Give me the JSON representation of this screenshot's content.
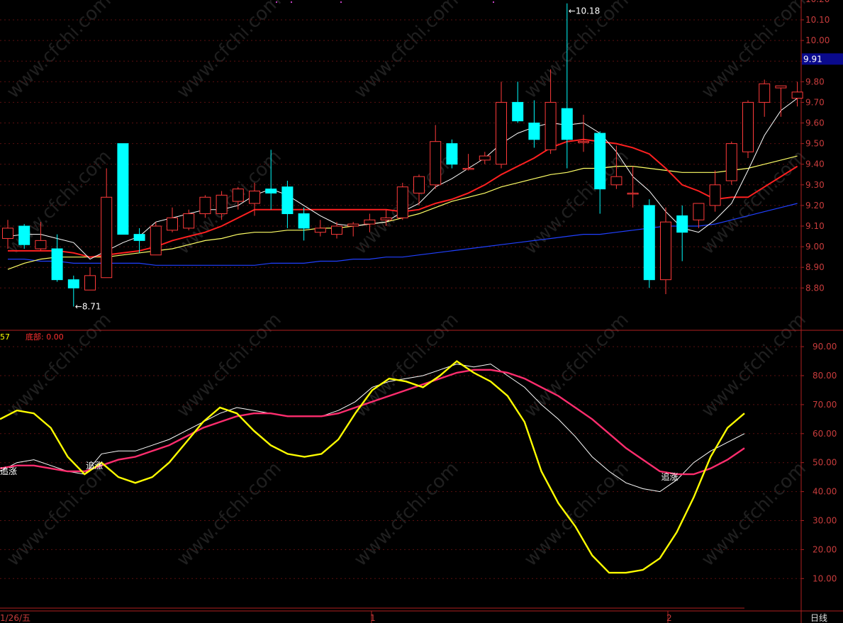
{
  "chart_data": [
    {
      "type": "candlestick",
      "colors": {
        "up": "#ff3a3a",
        "down": "#00ffff",
        "ma5": "#ffffff",
        "ma10": "#ff2020",
        "ma20": "#ffff66",
        "ma60": "#2040ff"
      },
      "ylim": [
        8.7,
        10.2
      ],
      "y_ticks": [
        "10.20",
        "10.10",
        "10.00",
        "9.90",
        "9.80",
        "9.70",
        "9.60",
        "9.50",
        "9.40",
        "9.30",
        "9.20",
        "9.10",
        "9.00",
        "8.90",
        "8.80"
      ],
      "current_price": "9.91",
      "annotations": {
        "high_label": "10.18",
        "low_label": "8.71"
      },
      "candles": [
        [
          9.04,
          9.09,
          8.99,
          9.13
        ],
        [
          9.1,
          9.01,
          8.99,
          9.11
        ],
        [
          8.99,
          9.03,
          8.98,
          9.12
        ],
        [
          8.99,
          8.84,
          8.83,
          9.06
        ],
        [
          8.84,
          8.8,
          8.71,
          8.86
        ],
        [
          8.79,
          8.86,
          8.79,
          8.9
        ],
        [
          8.85,
          9.24,
          8.85,
          9.38
        ],
        [
          9.5,
          9.06,
          9.06,
          9.5
        ],
        [
          9.06,
          9.03,
          8.97,
          9.09
        ],
        [
          8.96,
          9.1,
          8.96,
          9.12
        ],
        [
          9.08,
          9.14,
          9.07,
          9.19
        ],
        [
          9.09,
          9.16,
          9.08,
          9.18
        ],
        [
          9.16,
          9.24,
          9.14,
          9.25
        ],
        [
          9.16,
          9.25,
          9.13,
          9.27
        ],
        [
          9.22,
          9.28,
          9.18,
          9.29
        ],
        [
          9.21,
          9.27,
          9.15,
          9.31
        ],
        [
          9.28,
          9.26,
          9.18,
          9.47
        ],
        [
          9.29,
          9.16,
          9.09,
          9.32
        ],
        [
          9.16,
          9.09,
          9.03,
          9.19
        ],
        [
          9.07,
          9.09,
          9.05,
          9.13
        ],
        [
          9.06,
          9.1,
          9.04,
          9.12
        ],
        [
          9.1,
          9.11,
          9.05,
          9.12
        ],
        [
          9.11,
          9.13,
          9.07,
          9.16
        ],
        [
          9.13,
          9.14,
          9.1,
          9.18
        ],
        [
          9.14,
          9.29,
          9.13,
          9.31
        ],
        [
          9.26,
          9.34,
          9.2,
          9.35
        ],
        [
          9.3,
          9.51,
          9.28,
          9.59
        ],
        [
          9.5,
          9.4,
          9.38,
          9.52
        ],
        [
          9.38,
          9.38,
          9.37,
          9.45
        ],
        [
          9.42,
          9.44,
          9.4,
          9.46
        ],
        [
          9.4,
          9.7,
          9.38,
          9.8
        ],
        [
          9.7,
          9.61,
          9.6,
          9.8
        ],
        [
          9.6,
          9.52,
          9.48,
          9.71
        ],
        [
          9.47,
          9.7,
          9.45,
          9.86
        ],
        [
          9.67,
          9.52,
          9.38,
          10.18
        ],
        [
          9.51,
          9.51,
          9.46,
          9.64
        ],
        [
          9.55,
          9.28,
          9.16,
          9.56
        ],
        [
          9.3,
          9.34,
          9.28,
          9.49
        ],
        [
          9.26,
          9.26,
          9.19,
          9.39
        ],
        [
          9.2,
          8.84,
          8.8,
          9.23
        ],
        [
          8.84,
          9.12,
          8.77,
          9.19
        ],
        [
          9.15,
          9.07,
          8.93,
          9.2
        ],
        [
          9.13,
          9.21,
          9.09,
          9.2
        ],
        [
          9.2,
          9.3,
          9.17,
          9.37
        ],
        [
          9.32,
          9.5,
          9.3,
          9.51
        ],
        [
          9.46,
          9.7,
          9.43,
          9.71
        ],
        [
          9.7,
          9.79,
          9.63,
          9.81
        ],
        [
          9.77,
          9.78,
          9.63,
          9.78
        ],
        [
          9.72,
          9.75,
          9.68,
          9.8
        ]
      ],
      "series": [
        {
          "values": [
            9.05,
            9.06,
            9.06,
            9.04,
            9.02,
            8.94,
            8.98,
            9.02,
            9.05,
            9.12,
            9.14,
            9.16,
            9.18,
            9.18,
            9.2,
            9.25,
            9.28,
            9.25,
            9.2,
            9.15,
            9.11,
            9.1,
            9.11,
            9.12,
            9.17,
            9.21,
            9.29,
            9.33,
            9.38,
            9.43,
            9.5,
            9.55,
            9.58,
            9.6,
            9.59,
            9.6,
            9.55,
            9.46,
            9.34,
            9.27,
            9.17,
            9.09,
            9.07,
            9.13,
            9.21,
            9.37,
            9.54,
            9.66,
            9.72
          ]
        },
        {
          "values": [
            8.98,
            8.98,
            8.98,
            8.98,
            8.97,
            8.95,
            8.96,
            8.97,
            8.98,
            9.0,
            9.03,
            9.05,
            9.07,
            9.1,
            9.14,
            9.18,
            9.18,
            9.18,
            9.18,
            9.18,
            9.18,
            9.18,
            9.18,
            9.18,
            9.17,
            9.18,
            9.21,
            9.23,
            9.26,
            9.3,
            9.35,
            9.39,
            9.43,
            9.48,
            9.51,
            9.52,
            9.51,
            9.5,
            9.48,
            9.45,
            9.38,
            9.3,
            9.27,
            9.23,
            9.24,
            9.24,
            9.29,
            9.34,
            9.39
          ]
        },
        {
          "values": [
            8.89,
            8.92,
            8.94,
            8.95,
            8.95,
            8.95,
            8.95,
            8.96,
            8.97,
            8.98,
            8.99,
            9.01,
            9.03,
            9.04,
            9.06,
            9.07,
            9.07,
            9.08,
            9.08,
            9.09,
            9.09,
            9.1,
            9.11,
            9.12,
            9.14,
            9.16,
            9.19,
            9.22,
            9.24,
            9.26,
            9.29,
            9.31,
            9.33,
            9.35,
            9.36,
            9.38,
            9.38,
            9.39,
            9.39,
            9.38,
            9.37,
            9.36,
            9.36,
            9.36,
            9.37,
            9.38,
            9.4,
            9.42,
            9.44
          ]
        },
        {
          "values": [
            8.94,
            8.94,
            8.93,
            8.93,
            8.92,
            8.92,
            8.92,
            8.92,
            8.92,
            8.91,
            8.91,
            8.91,
            8.91,
            8.91,
            8.91,
            8.91,
            8.92,
            8.92,
            8.92,
            8.93,
            8.93,
            8.94,
            8.94,
            8.95,
            8.95,
            8.96,
            8.97,
            8.98,
            8.99,
            9.0,
            9.01,
            9.02,
            9.03,
            9.04,
            9.05,
            9.06,
            9.06,
            9.07,
            9.08,
            9.09,
            9.1,
            9.1,
            9.1,
            9.11,
            9.13,
            9.15,
            9.17,
            9.19,
            9.21
          ]
        }
      ]
    },
    {
      "type": "line",
      "labels": {
        "prefix": "57",
        "bottom_label": "底部: 0.00"
      },
      "ylim": [
        0,
        95
      ],
      "y_ticks": [
        "90.00",
        "80.00",
        "70.00",
        "60.00",
        "50.00",
        "40.00",
        "30.00",
        "20.00",
        "10.00"
      ],
      "signals": [
        {
          "text": "追涨",
          "x_index": 0,
          "y": 47
        },
        {
          "text": "追涨",
          "x_index": 6,
          "y": 49
        },
        {
          "text": "追涨",
          "x_index": 40,
          "y": 45
        }
      ],
      "series": [
        {
          "color": "#ffff00",
          "values": [
            65,
            68,
            67,
            62,
            52,
            46,
            50,
            45,
            43,
            45,
            50,
            57,
            64,
            69,
            67,
            61,
            56,
            53,
            52,
            53,
            58,
            67,
            75,
            79,
            78,
            76,
            80,
            85,
            81,
            78,
            73,
            64,
            47,
            36,
            28,
            18,
            12,
            12,
            13,
            17,
            26,
            38,
            52,
            62,
            67
          ]
        },
        {
          "color": "#ff2d6e",
          "values": [
            48,
            49,
            49,
            48,
            47,
            47,
            49,
            51,
            52,
            54,
            56,
            59,
            62,
            64,
            66,
            67,
            67,
            66,
            66,
            66,
            67,
            69,
            71,
            73,
            75,
            77,
            79,
            81,
            82,
            82,
            81,
            79,
            76,
            73,
            69,
            65,
            60,
            55,
            51,
            47,
            46,
            46,
            48,
            51,
            55
          ]
        },
        {
          "color": "#ffffff",
          "values": [
            47,
            50,
            51,
            49,
            47,
            46,
            53,
            54,
            54,
            56,
            58,
            61,
            64,
            67,
            69,
            68,
            67,
            66,
            66,
            66,
            68,
            71,
            76,
            78,
            79,
            80,
            82,
            84,
            83,
            84,
            80,
            76,
            70,
            65,
            59,
            52,
            47,
            43,
            41,
            40,
            44,
            50,
            54,
            57,
            60
          ]
        }
      ]
    }
  ],
  "x_axis": {
    "labels": [
      "1/26/五",
      "1",
      "2"
    ],
    "period_label": "日线"
  },
  "watermark": "www.cfchi.com"
}
